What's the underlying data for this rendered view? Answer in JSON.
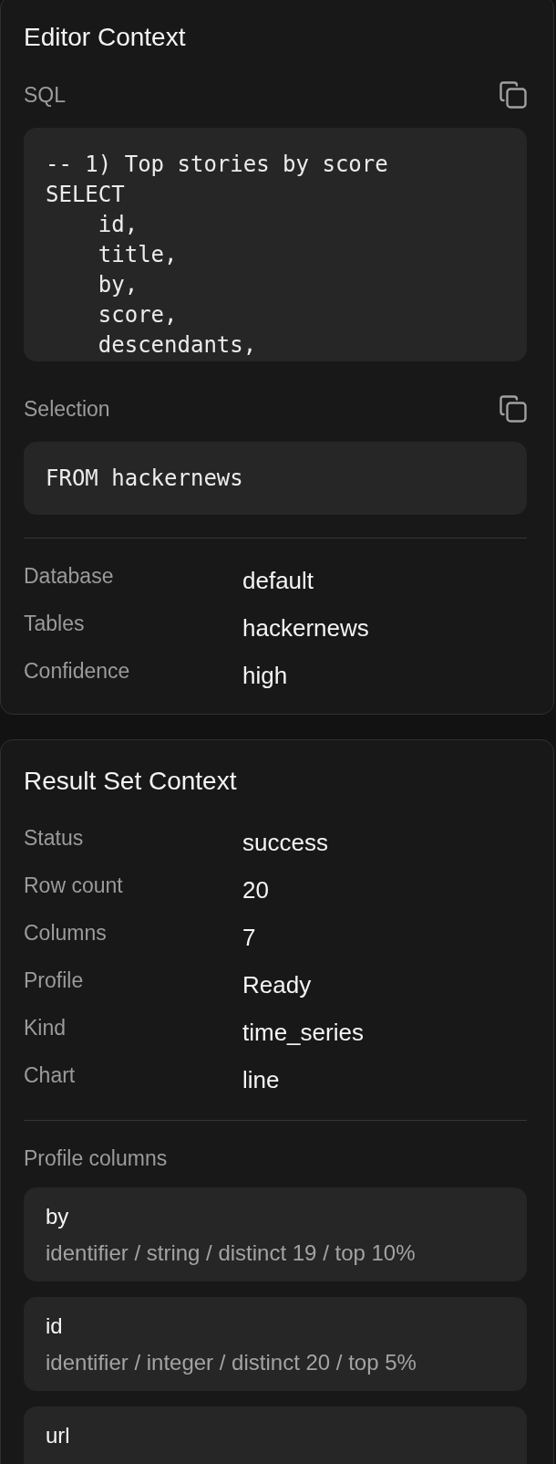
{
  "panels": [
    {
      "title": "Editor Context",
      "sections": [
        {
          "kind": "code",
          "label": "SQL",
          "code": "-- 1) Top stories by score\nSELECT\n    id,\n    title,\n    by,\n    score,\n    descendants,"
        },
        {
          "kind": "code",
          "label": "Selection",
          "code": "FROM hackernews"
        },
        {
          "kind": "fields",
          "rows": [
            {
              "label": "Database",
              "value": "default"
            },
            {
              "label": "Tables",
              "value": "hackernews"
            },
            {
              "label": "Confidence",
              "value": "high"
            }
          ]
        }
      ]
    },
    {
      "title": "Result Set Context",
      "sections": [
        {
          "kind": "fields",
          "rows": [
            {
              "label": "Status",
              "value": "success"
            },
            {
              "label": "Row count",
              "value": "20"
            },
            {
              "label": "Columns",
              "value": "7"
            },
            {
              "label": "Profile",
              "value": "Ready"
            },
            {
              "label": "Kind",
              "value": "time_series"
            },
            {
              "label": "Chart",
              "value": "line"
            }
          ]
        },
        {
          "kind": "profile",
          "label": "Profile columns",
          "columns": [
            {
              "name": "by",
              "detail": "identifier / string / distinct 19 / top 10%"
            },
            {
              "name": "id",
              "detail": "identifier / integer / distinct 20 / top 5%"
            },
            {
              "name": "url"
            }
          ]
        }
      ]
    }
  ]
}
